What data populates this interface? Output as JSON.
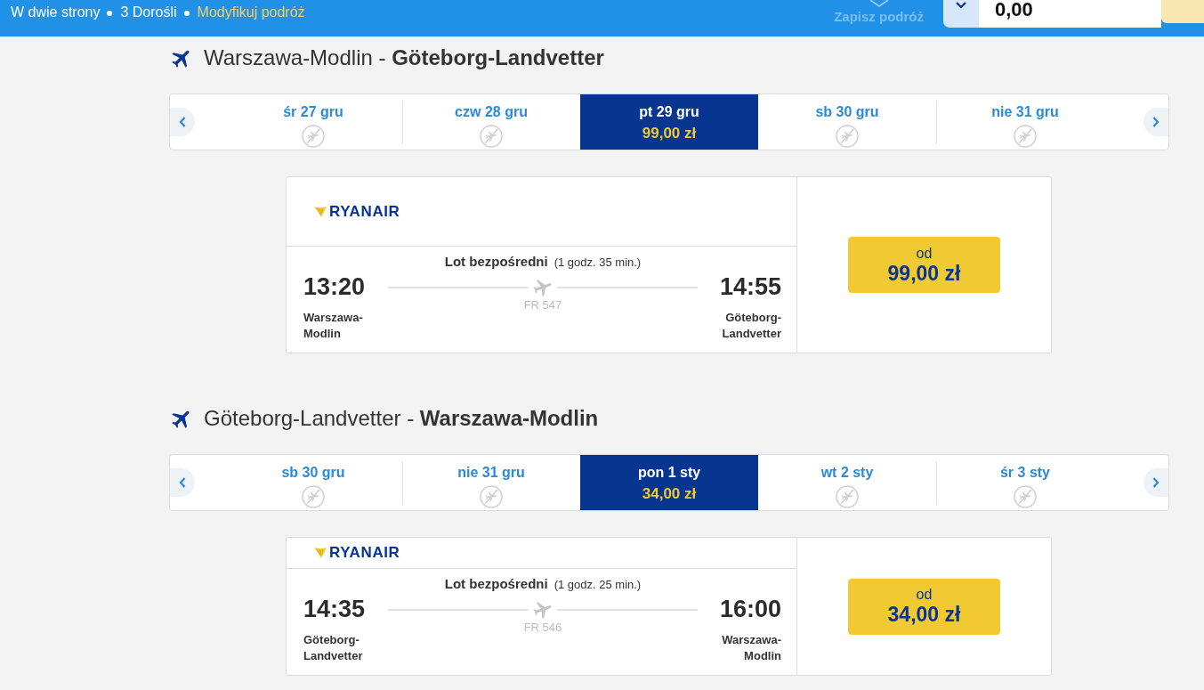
{
  "top_bar": {
    "trip_summary": [
      {
        "text": "W dwie strony",
        "kind": "info"
      },
      {
        "text": "3 Dorośli",
        "kind": "info"
      },
      {
        "text": "Modyfikuj podróż",
        "kind": "link"
      }
    ],
    "save_trip": {
      "label": "Zapisz podróż",
      "disabled": true
    },
    "total": {
      "value": "0,00"
    }
  },
  "journeys": [
    {
      "heading": "Warszawa-Modlin - **Göteborg-Landvetter**",
      "dates": [
        {
          "label": "śr 27 gru",
          "available": false,
          "selected": false
        },
        {
          "label": "czw 28 gru",
          "available": false,
          "selected": false
        },
        {
          "label": "pt 29 gru",
          "available": true,
          "price": "99,00 zł",
          "selected": true
        },
        {
          "label": "sb 30 gru",
          "available": false,
          "selected": false
        },
        {
          "label": "nie 31 gru",
          "available": false,
          "selected": false
        }
      ],
      "flight": {
        "airline": "RYANAIR",
        "type": "Lot bezpośredni",
        "duration": "(1 godz. 35 min.)",
        "departure_time": "13:20",
        "departure_airport": "Warszawa-Modlin",
        "flight_number": "FR 547",
        "arrival_time": "14:55",
        "arrival_airport": "Göteborg-Landvetter",
        "price_prefix": "od",
        "price": "99,00 zł"
      }
    },
    {
      "heading": "Göteborg-Landvetter - **Warszawa-Modlin**",
      "dates": [
        {
          "label": "sb 30 gru",
          "available": false,
          "selected": false
        },
        {
          "label": "nie 31 gru",
          "available": false,
          "selected": false
        },
        {
          "label": "pon 1 sty",
          "available": true,
          "price": "34,00 zł",
          "selected": true
        },
        {
          "label": "wt 2 sty",
          "available": false,
          "selected": false
        },
        {
          "label": "śr 3 sty",
          "available": false,
          "selected": false
        }
      ],
      "flight": {
        "airline": "RYANAIR",
        "type": "Lot bezpośredni",
        "duration": "(1 godz. 25 min.)",
        "departure_time": "14:35",
        "departure_airport": "Göteborg-Landvetter",
        "flight_number": "FR 546",
        "arrival_time": "16:00",
        "arrival_airport": "Warszawa-Modlin",
        "price_prefix": "od",
        "price": "34,00 zł"
      }
    }
  ]
}
